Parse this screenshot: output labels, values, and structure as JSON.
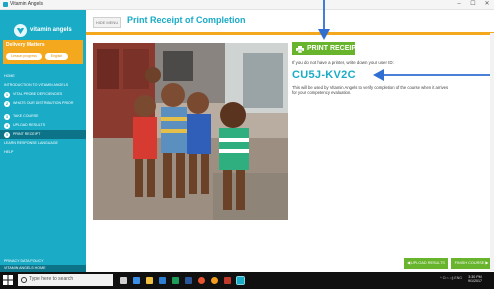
{
  "window": {
    "title": "Vitamin Angels",
    "controls": [
      "–",
      "☐",
      "✕"
    ]
  },
  "sidebar": {
    "logo": "vitamin angels",
    "course_title": "Delivery Matters",
    "pills": [
      "Lesson progress",
      "English"
    ],
    "menu": [
      {
        "label": "HOME",
        "number": ""
      },
      {
        "label": "INTRODUCTION TO VITAMIN ANGELS",
        "number": ""
      },
      {
        "label": "VITAL PROBE DEFICIENCIES",
        "number": "1"
      },
      {
        "label": "WHATS OUR DISTRIBUTION PRIOR",
        "number": "2"
      },
      {
        "label": "TAKE COURSE",
        "number": "3"
      },
      {
        "label": "UPLOAD RESULTS",
        "number": "4"
      },
      {
        "label": "PRINT RECEIPT",
        "number": "5"
      },
      {
        "label": "LEARN RESPONSE LANGUAGE",
        "number": ""
      },
      {
        "label": "HELP",
        "number": ""
      }
    ],
    "active_index": 6,
    "bottom_links": [
      "PRIVACY DATA POLICY",
      "VITAMIN ANGELS HOME"
    ]
  },
  "header": {
    "hide_menu": "HIDE MENU",
    "title": "Print Receipt of Completion"
  },
  "content": {
    "print_button": "PRINT RECEIPT",
    "no_printer_text": "If you do not have a printer, write down your user ID:",
    "user_code": "CU5J-KV2C",
    "usage_text": "This will be used by Vitamin Angels to verify completion of the course when it arrives for your competency evaluation."
  },
  "nav_buttons": {
    "prev": "◀ UPLOAD RESULTS",
    "next": "FINISH COURSE ▶"
  },
  "taskbar": {
    "search_placeholder": "Type here to search",
    "tray": "^ ⊡ ⌂ ◁) ENG",
    "time": "3:30 PM",
    "date": "9/1/2017"
  },
  "colors": {
    "accent": "#1aabc6",
    "orange": "#f4a81d",
    "green": "#68b42c",
    "arrow": "#2f6fd1"
  }
}
